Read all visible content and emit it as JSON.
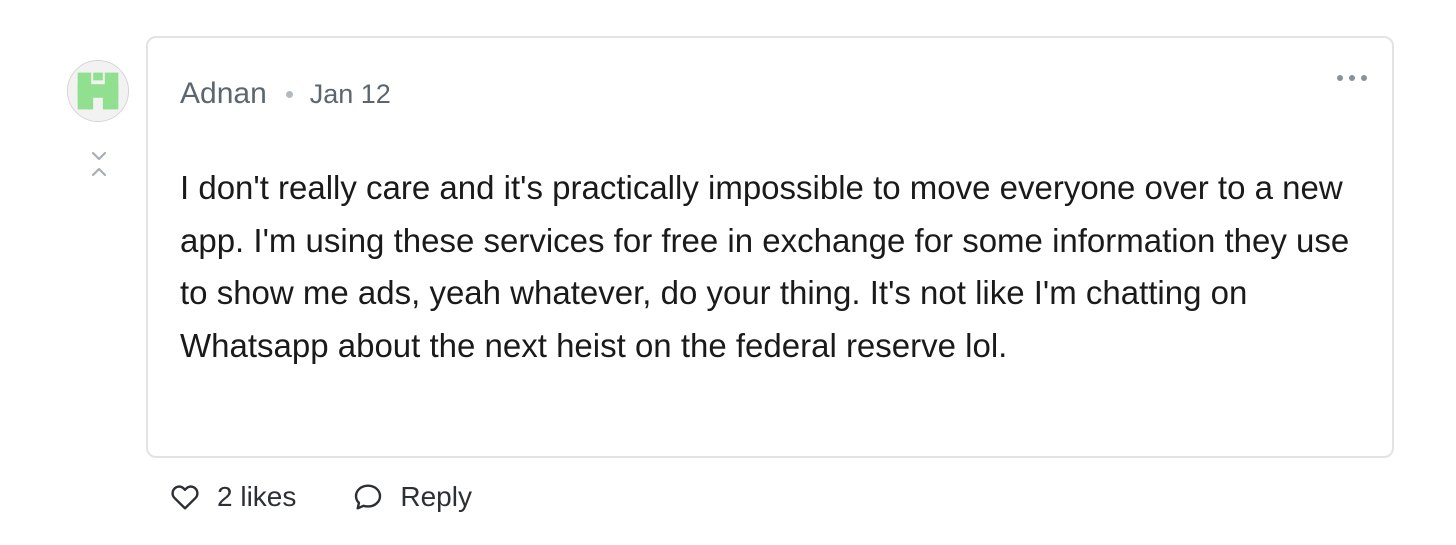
{
  "comment": {
    "author": "Adnan",
    "date": "Jan 12",
    "text": "I don't really care and it's practically impossible to move everyone over to a new app. I'm using these services for free in exchange for some information they use to show me ads, yeah whatever, do your thing. It's not like I'm chatting on Whatsapp about the next heist on the federal reserve lol."
  },
  "actions": {
    "likes_label": "2 likes",
    "reply_label": "Reply"
  },
  "icons": {
    "avatar": "identicon-avatar",
    "collapse": "collapse-chevrons-icon",
    "more": "more-options-icon",
    "like": "heart-icon",
    "reply": "speech-bubble-icon"
  },
  "colors": {
    "avatar_accent": "#90e08f",
    "card_border": "#e3e3e3",
    "meta_text": "#5c6670"
  }
}
